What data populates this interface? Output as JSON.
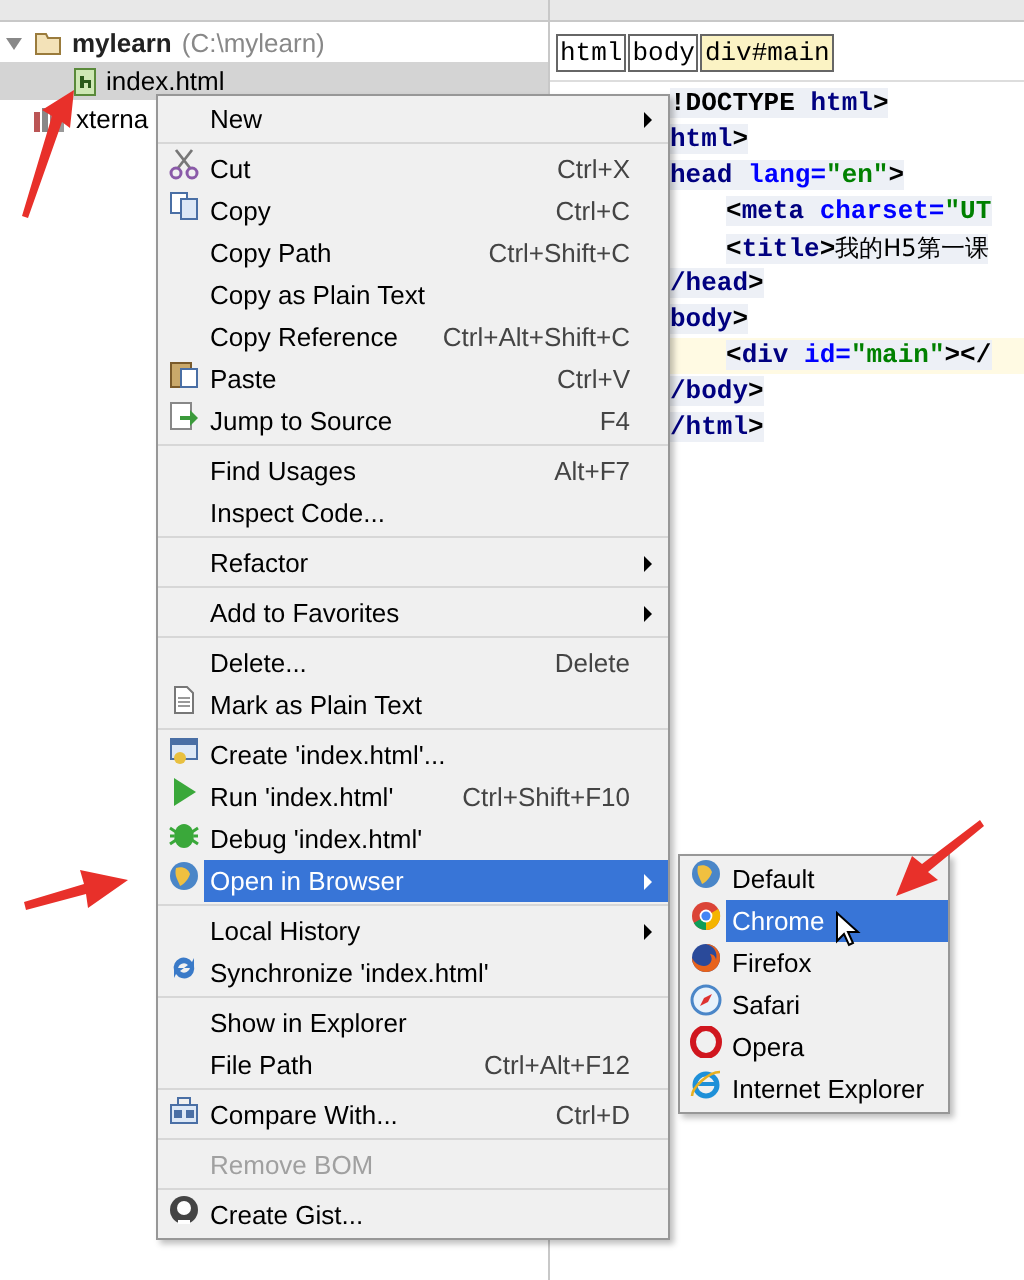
{
  "project_tree": [
    {
      "label": "mylearn",
      "path": "(C:\\mylearn)",
      "kind": "folder",
      "selected": false,
      "expanded": true,
      "children": [
        {
          "label": "index.html",
          "kind": "html",
          "selected": true
        }
      ]
    },
    {
      "label": "xterna",
      "kind": "library",
      "selected": false
    }
  ],
  "breadcrumbs": [
    {
      "label": "html",
      "selected": false
    },
    {
      "label": "body",
      "selected": false
    },
    {
      "label": "div#main",
      "selected": true
    }
  ],
  "code_lines": [
    {
      "indented": false,
      "current": false,
      "segments": [
        {
          "text": "!DOCTYPE ",
          "kind": "plain"
        },
        {
          "text": "html",
          "kind": "tag"
        },
        {
          "text": ">",
          "kind": "plain"
        }
      ]
    },
    {
      "indented": false,
      "current": false,
      "segments": [
        {
          "text": "html",
          "kind": "tag"
        },
        {
          "text": ">",
          "kind": "plain"
        }
      ]
    },
    {
      "indented": false,
      "current": false,
      "segments": [
        {
          "text": "head ",
          "kind": "tag"
        },
        {
          "text": "lang=",
          "kind": "attr"
        },
        {
          "text": "\"en\"",
          "kind": "value"
        },
        {
          "text": ">",
          "kind": "plain"
        }
      ]
    },
    {
      "indented": true,
      "current": false,
      "segments": [
        {
          "text": "<",
          "kind": "plain"
        },
        {
          "text": "meta ",
          "kind": "tag"
        },
        {
          "text": "charset=",
          "kind": "attr"
        },
        {
          "text": "\"UT",
          "kind": "value"
        }
      ]
    },
    {
      "indented": true,
      "current": false,
      "segments": [
        {
          "text": "<",
          "kind": "plain"
        },
        {
          "text": "title",
          "kind": "tag"
        },
        {
          "text": ">",
          "kind": "plain"
        },
        {
          "text": "我的H5第一课",
          "kind": "text"
        }
      ]
    },
    {
      "indented": false,
      "current": false,
      "segments": [
        {
          "text": "/head",
          "kind": "tag"
        },
        {
          "text": ">",
          "kind": "plain"
        }
      ]
    },
    {
      "indented": false,
      "current": false,
      "segments": [
        {
          "text": "body",
          "kind": "tag"
        },
        {
          "text": ">",
          "kind": "plain"
        }
      ]
    },
    {
      "indented": true,
      "current": true,
      "segments": [
        {
          "text": "<",
          "kind": "plain"
        },
        {
          "text": "div ",
          "kind": "tag"
        },
        {
          "text": "id=",
          "kind": "attr"
        },
        {
          "text": "\"main\"",
          "kind": "value"
        },
        {
          "text": "></",
          "kind": "plain"
        }
      ]
    },
    {
      "indented": false,
      "current": false,
      "segments": [
        {
          "text": "/body",
          "kind": "tag"
        },
        {
          "text": ">",
          "kind": "plain"
        }
      ]
    },
    {
      "indented": false,
      "current": false,
      "segments": [
        {
          "text": "/html",
          "kind": "tag"
        },
        {
          "text": ">",
          "kind": "plain"
        }
      ]
    }
  ],
  "context_menu": {
    "groups": [
      [
        {
          "label": "New",
          "submenu": true,
          "selected": false,
          "disabled": false
        }
      ],
      [
        {
          "label": "Cut",
          "shortcut": "Ctrl+X",
          "kind": "cut",
          "submenu": false,
          "selected": false,
          "disabled": false
        },
        {
          "label": "Copy",
          "shortcut": "Ctrl+C",
          "kind": "copy",
          "submenu": false,
          "selected": false,
          "disabled": false
        },
        {
          "label": "Copy Path",
          "shortcut": "Ctrl+Shift+C",
          "submenu": false,
          "selected": false,
          "disabled": false
        },
        {
          "label": "Copy as Plain Text",
          "submenu": false,
          "selected": false,
          "disabled": false
        },
        {
          "label": "Copy Reference",
          "shortcut": "Ctrl+Alt+Shift+C",
          "submenu": false,
          "selected": false,
          "disabled": false
        },
        {
          "label": "Paste",
          "shortcut": "Ctrl+V",
          "kind": "paste",
          "submenu": false,
          "selected": false,
          "disabled": false
        },
        {
          "label": "Jump to Source",
          "shortcut": "F4",
          "kind": "jump",
          "submenu": false,
          "selected": false,
          "disabled": false
        }
      ],
      [
        {
          "label": "Find Usages",
          "shortcut": "Alt+F7",
          "submenu": false,
          "selected": false,
          "disabled": false
        },
        {
          "label": "Inspect Code...",
          "submenu": false,
          "selected": false,
          "disabled": false
        }
      ],
      [
        {
          "label": "Refactor",
          "submenu": true,
          "selected": false,
          "disabled": false
        }
      ],
      [
        {
          "label": "Add to Favorites",
          "submenu": true,
          "selected": false,
          "disabled": false
        }
      ],
      [
        {
          "label": "Delete...",
          "shortcut": "Delete",
          "submenu": false,
          "selected": false,
          "disabled": false
        },
        {
          "label": "Mark as Plain Text",
          "kind": "document",
          "submenu": false,
          "selected": false,
          "disabled": false
        }
      ],
      [
        {
          "label": "Create 'index.html'...",
          "kind": "create",
          "submenu": false,
          "selected": false,
          "disabled": false
        },
        {
          "label": "Run 'index.html'",
          "shortcut": "Ctrl+Shift+F10",
          "kind": "run",
          "submenu": false,
          "selected": false,
          "disabled": false
        },
        {
          "label": "Debug 'index.html'",
          "kind": "debug",
          "submenu": false,
          "selected": false,
          "disabled": false
        },
        {
          "label": "Open in Browser",
          "kind": "browser",
          "submenu": true,
          "selected": true,
          "disabled": false
        }
      ],
      [
        {
          "label": "Local History",
          "submenu": true,
          "selected": false,
          "disabled": false
        },
        {
          "label": "Synchronize 'index.html'",
          "kind": "sync",
          "submenu": false,
          "selected": false,
          "disabled": false
        }
      ],
      [
        {
          "label": "Show in Explorer",
          "submenu": false,
          "selected": false,
          "disabled": false
        },
        {
          "label": "File Path",
          "shortcut": "Ctrl+Alt+F12",
          "submenu": false,
          "selected": false,
          "disabled": false
        }
      ],
      [
        {
          "label": "Compare With...",
          "shortcut": "Ctrl+D",
          "kind": "compare",
          "submenu": false,
          "selected": false,
          "disabled": false
        }
      ],
      [
        {
          "label": "Remove BOM",
          "submenu": false,
          "selected": false,
          "disabled": true
        }
      ],
      [
        {
          "label": "Create Gist...",
          "kind": "gist",
          "submenu": false,
          "selected": false,
          "disabled": false
        }
      ]
    ]
  },
  "browser_submenu": {
    "groups": [
      [
        {
          "label": "Default",
          "kind": "browser",
          "submenu": false,
          "selected": false,
          "disabled": false
        },
        {
          "label": "Chrome",
          "kind": "chrome",
          "submenu": false,
          "selected": true,
          "disabled": false
        },
        {
          "label": "Firefox",
          "kind": "firefox",
          "submenu": false,
          "selected": false,
          "disabled": false
        },
        {
          "label": "Safari",
          "kind": "safari",
          "submenu": false,
          "selected": false,
          "disabled": false
        },
        {
          "label": "Opera",
          "kind": "opera",
          "submenu": false,
          "selected": false,
          "disabled": false
        },
        {
          "label": "Internet Explorer",
          "kind": "ie",
          "submenu": false,
          "selected": false,
          "disabled": false
        }
      ]
    ]
  }
}
